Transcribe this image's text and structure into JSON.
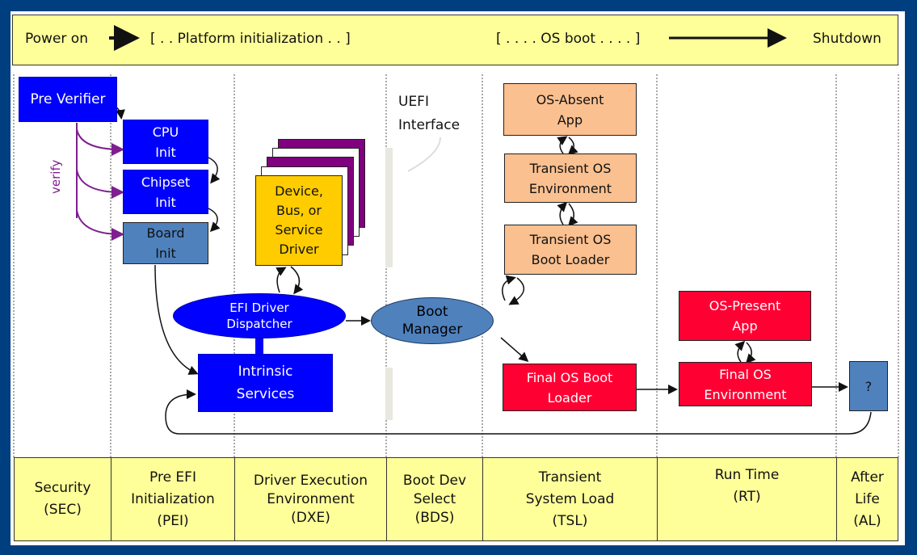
{
  "header": {
    "power_on": "Power on",
    "platform_init": "[ . . Platform initialization . . ]",
    "os_boot": "[ . . . . OS boot . . . . ]",
    "shutdown": "Shutdown"
  },
  "colors": {
    "frame": "#003f7f",
    "band": "#ffff99",
    "pei_blue": "#0000ff",
    "steel": "#4f81bd",
    "peach": "#fac090",
    "red": "#ff0033",
    "driver": "#ffcc00",
    "verify": "#7f1f8f"
  },
  "nodes": {
    "pre_verifier": "Pre Verifier",
    "verify": "verify",
    "cpu_init": "CPU\nInit",
    "chipset_init": "Chipset\nInit",
    "board_init": "Board\nInit",
    "driver": "Device,\nBus, or\nService\nDriver",
    "dispatcher": "EFI Driver\nDispatcher",
    "intrinsic": "Intrinsic\nServices",
    "uefi_interface": "UEFI\nInterface",
    "boot_manager": "Boot\nManager",
    "os_absent_app": "OS-Absent\nApp",
    "transient_env": "Transient OS\nEnvironment",
    "transient_loader": "Transient OS\nBoot Loader",
    "final_loader": "Final OS Boot\nLoader",
    "os_present_app": "OS-Present\nApp",
    "final_env": "Final OS\nEnvironment",
    "afterlife": "?"
  },
  "phases": [
    {
      "label": "Security\n(SEC)"
    },
    {
      "label": "Pre EFI\nInitialization\n(PEI)"
    },
    {
      "label": "Driver Execution\nEnvironment\n(DXE)"
    },
    {
      "label": "Boot Dev\nSelect\n(BDS)"
    },
    {
      "label": "Transient\nSystem Load\n(TSL)"
    },
    {
      "label": "Run Time\n(RT)"
    },
    {
      "label": "After\nLife\n(AL)"
    }
  ]
}
